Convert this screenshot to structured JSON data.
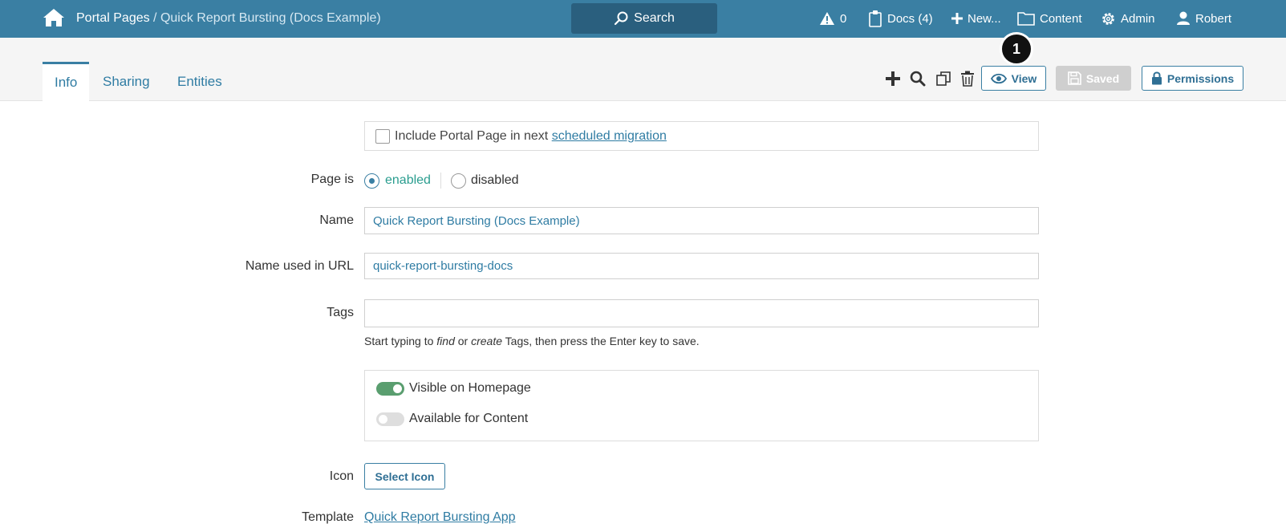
{
  "header": {
    "breadcrumb_root": "Portal Pages",
    "breadcrumb_sep": " / ",
    "breadcrumb_current": "Quick Report Bursting (Docs Example)",
    "search_label": "Search",
    "alerts_count": "0",
    "docs_label": "Docs (4)",
    "new_label": "New...",
    "content_label": "Content",
    "admin_label": "Admin",
    "user_label": "Robert"
  },
  "tabs": [
    {
      "label": "Info"
    },
    {
      "label": "Sharing"
    },
    {
      "label": "Entities"
    }
  ],
  "toolbar": {
    "view_label": "View",
    "saved_label": "Saved",
    "permissions_label": "Permissions",
    "step_marker": "1"
  },
  "form": {
    "migration_text": "Include Portal Page in next ",
    "migration_link": "scheduled migration",
    "page_is_label": "Page is",
    "enabled_label": "enabled",
    "disabled_label": "disabled",
    "name_label": "Name",
    "name_value": "Quick Report Bursting (Docs Example)",
    "url_label": "Name used in URL",
    "url_value": "quick-report-bursting-docs",
    "tags_label": "Tags",
    "tags_value": "",
    "tags_help_1": "Start typing to ",
    "tags_help_find": "find",
    "tags_help_2": " or ",
    "tags_help_create": "create",
    "tags_help_3": " Tags, then press the Enter key to save.",
    "visible_homepage_label": "Visible on Homepage",
    "available_content_label": "Available for Content",
    "icon_label": "Icon",
    "select_icon_label": "Select Icon",
    "template_label": "Template",
    "template_link": "Quick Report Bursting App"
  },
  "colors": {
    "header_bg": "#3a7fa3",
    "search_bg": "#2a5f7e",
    "accent": "#2f7ca3",
    "toggle_on": "#5a9e6f"
  }
}
